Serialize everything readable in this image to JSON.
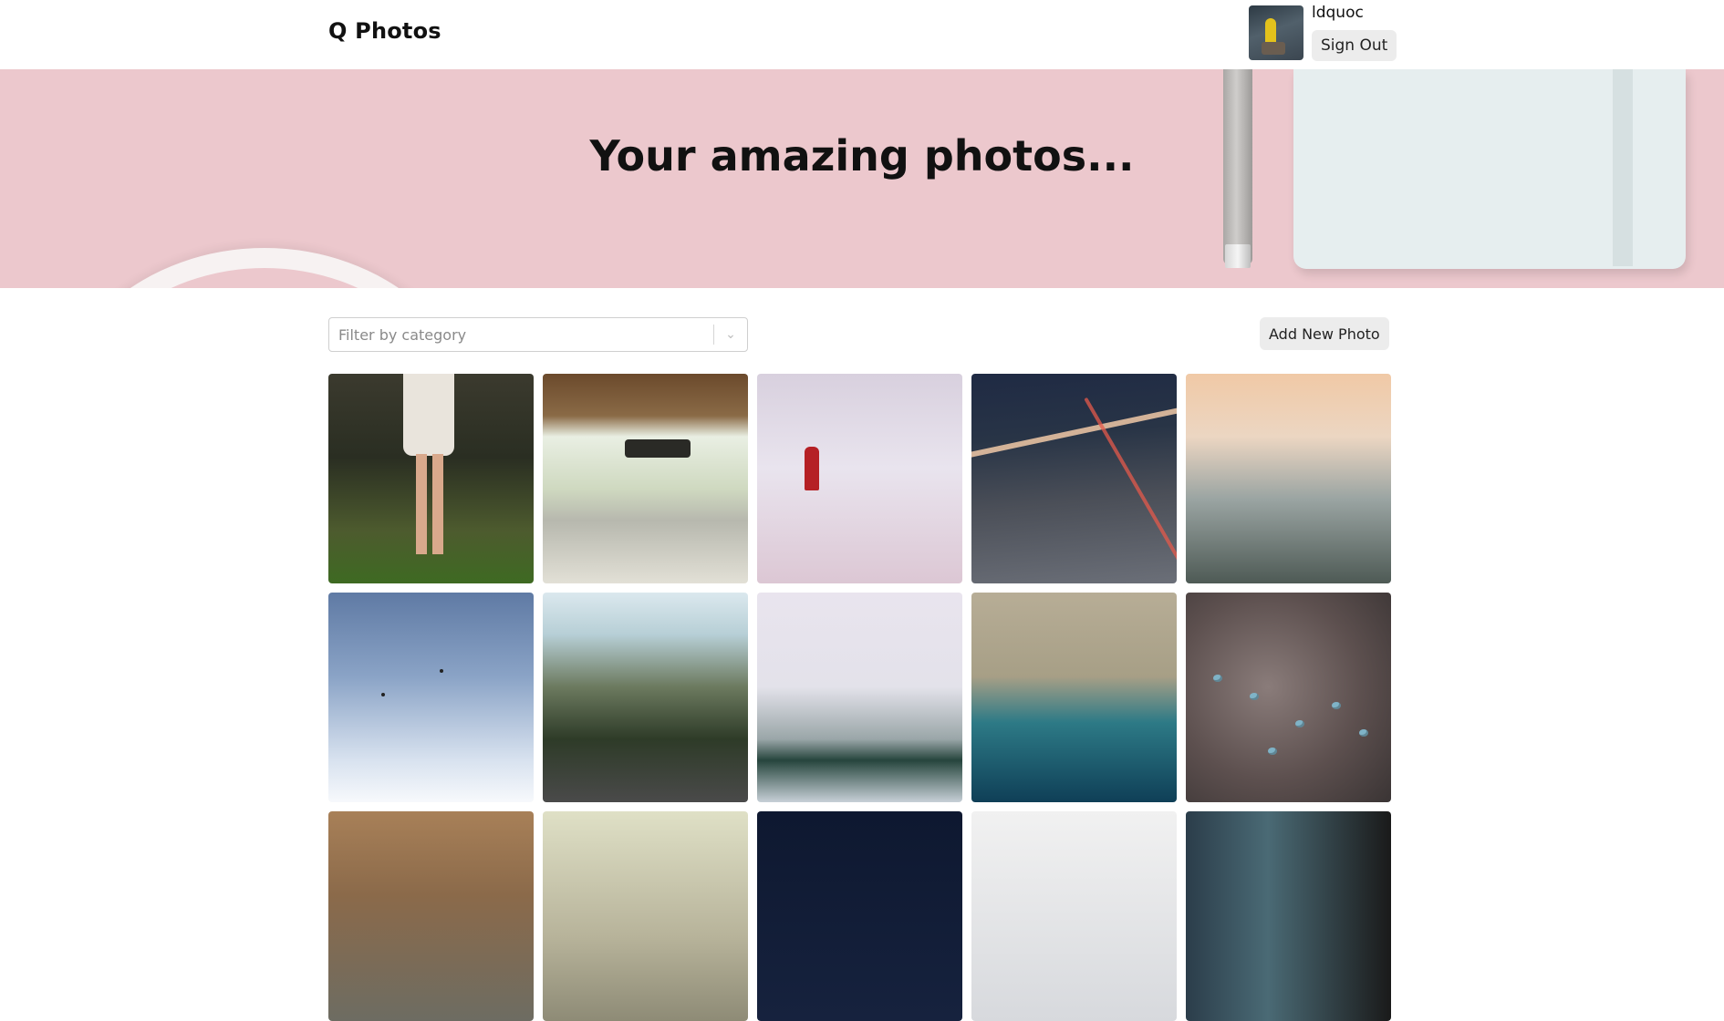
{
  "header": {
    "brand": "Q Photos",
    "username": "ldquoc",
    "sign_out_label": "Sign Out"
  },
  "hero": {
    "title": "Your amazing photos..."
  },
  "toolbar": {
    "filter_placeholder": "Filter by category",
    "add_photo_label": "Add New Photo"
  },
  "gallery": {
    "photo_count_visible": 15
  },
  "colors": {
    "hero_bg": "#ecc8cd",
    "button_bg": "#ececec"
  }
}
